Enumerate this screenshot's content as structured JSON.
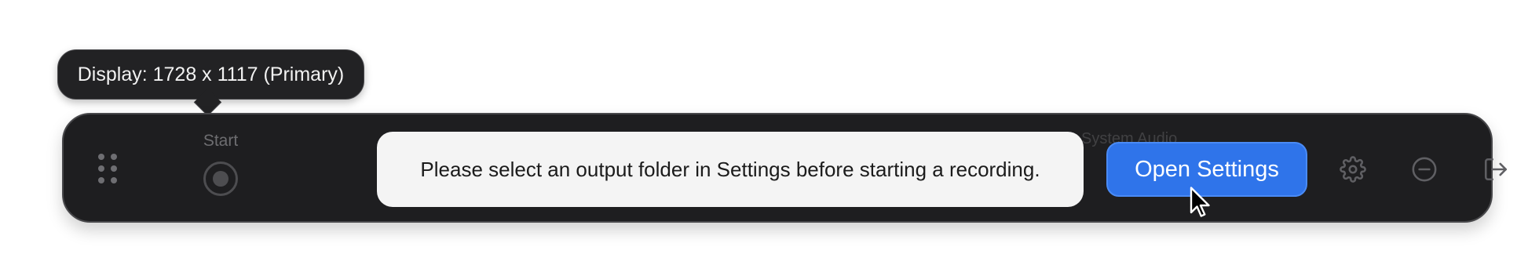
{
  "tooltip": {
    "text": "Display: 1728 x 1117 (Primary)"
  },
  "toolbar": {
    "start_label": "Start",
    "obscured_labels": [
      "System Audio"
    ],
    "alert_message": "Please select an output folder in Settings before starting a recording.",
    "open_settings_label": "Open Settings"
  },
  "icons": {
    "grip": "grip-dots-icon",
    "record": "record-icon",
    "settings": "gear-icon",
    "minimize": "minus-circle-icon",
    "exit": "logout-icon",
    "cursor": "mouse-pointer-icon"
  },
  "colors": {
    "toolbar_bg": "#1e1e20",
    "accent": "#2f74ea",
    "alert_bg": "#f4f4f4",
    "tooltip_bg": "#222224"
  }
}
